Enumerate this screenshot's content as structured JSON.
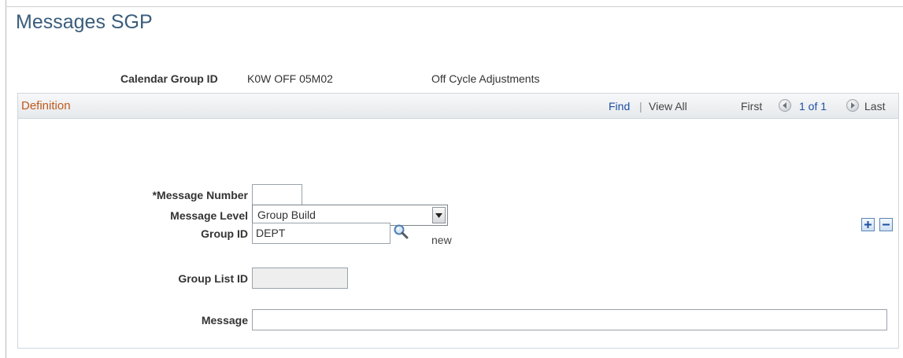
{
  "page": {
    "title": "Messages SGP"
  },
  "header": {
    "calendar_group_label": "Calendar Group ID",
    "calendar_group_value": "K0W OFF 05M02",
    "calendar_group_desc": "Off Cycle Adjustments"
  },
  "grid": {
    "title": "Definition",
    "find": "Find",
    "separator": "|",
    "view_all": "View All",
    "first": "First",
    "count": "1 of 1",
    "last": "Last"
  },
  "form": {
    "message_number_label": "*Message Number",
    "message_number_value": "",
    "message_level_label": "Message Level",
    "message_level_value": "Group Build",
    "group_id_label": "Group ID",
    "group_id_value": "DEPT",
    "group_id_status": "new",
    "group_list_id_label": "Group List ID",
    "group_list_id_value": "",
    "message_label": "Message",
    "message_value": ""
  },
  "icons": {
    "previous": "prev-arrow-icon",
    "next": "next-arrow-icon",
    "add_row": "plus-icon",
    "delete_row": "minus-icon",
    "lookup": "magnifier-icon",
    "dropdown": "chevron-down-icon"
  },
  "colors": {
    "title": "#3a5d7c",
    "grid_title": "#c05a1c",
    "link": "#1f4fa3"
  }
}
